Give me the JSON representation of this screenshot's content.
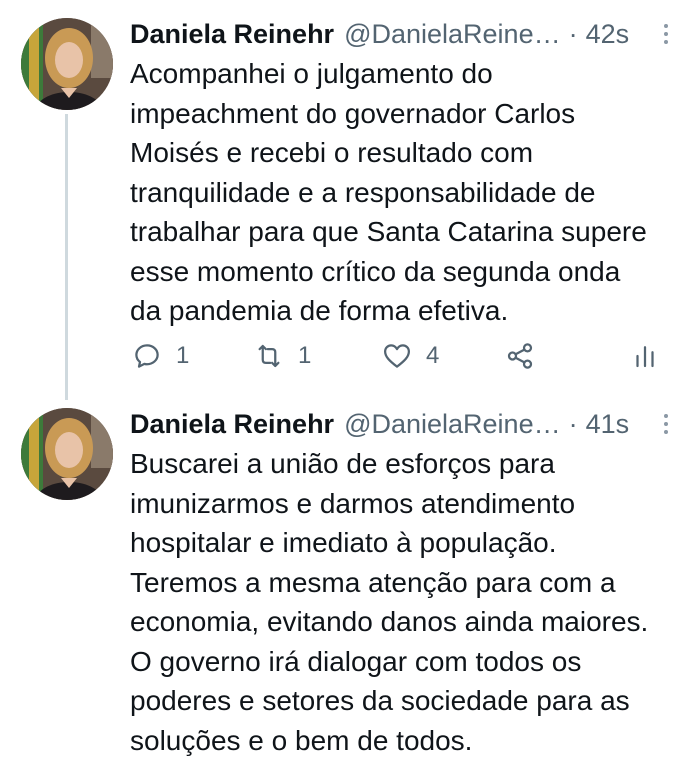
{
  "tweets": [
    {
      "author_name": "Daniela Reinehr",
      "handle": "@DanielaReine…",
      "separator": "·",
      "time": "42s",
      "text_lines": [
        "Acompanhei o julgamento do",
        "impeachment do governador Carlos",
        "Moisés e recebi o resultado com",
        "tranquilidade e a responsabilidade de",
        "trabalhar para que Santa Catarina supere",
        "esse momento crítico da segunda onda",
        "da pandemia de forma efetiva."
      ],
      "actions": {
        "reply_count": "1",
        "retweet_count": "1",
        "like_count": "4"
      }
    },
    {
      "author_name": "Daniela Reinehr",
      "handle": "@DanielaReine…",
      "separator": "·",
      "time": "41s",
      "text_lines": [
        "Buscarei a união de esforços para",
        "imunizarmos e darmos atendimento",
        "hospitalar e imediato à população.",
        "Teremos a mesma atenção para com a",
        "economia, evitando danos ainda maiores.",
        "O governo irá dialogar com todos os",
        "poderes e setores da sociedade para as",
        "soluções e o bem de todos."
      ]
    }
  ],
  "icons": {
    "reply": "reply-icon",
    "retweet": "retweet-icon",
    "like": "heart-icon",
    "share": "share-icon",
    "analytics": "analytics-icon",
    "more": "more-vertical-icon"
  },
  "colors": {
    "text": "#0f1419",
    "secondary": "#536471",
    "thread_line": "#cfd9de"
  }
}
